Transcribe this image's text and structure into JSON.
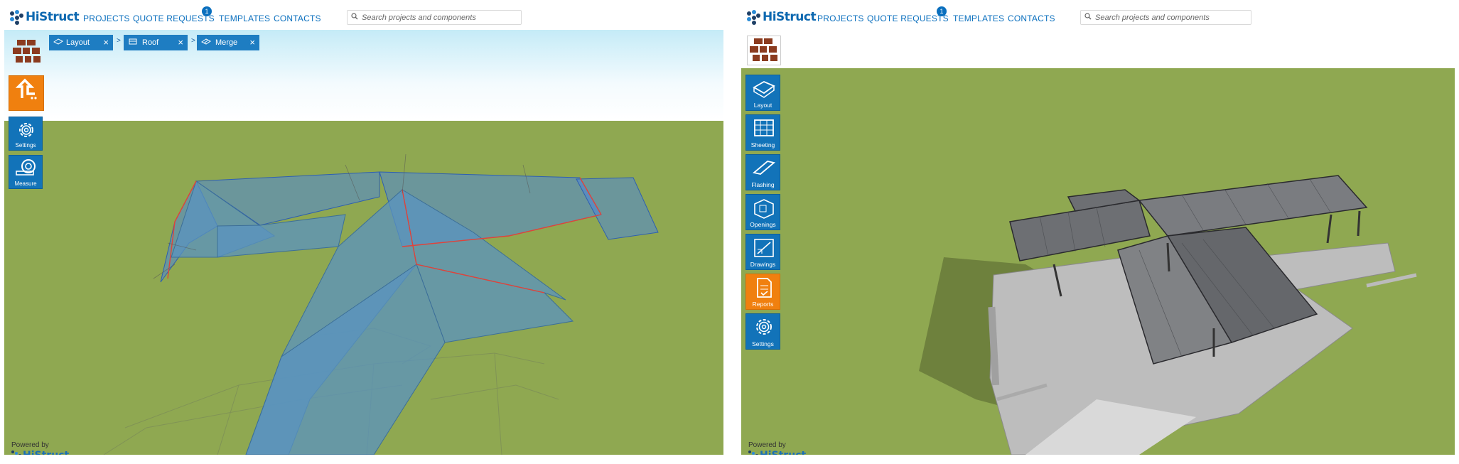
{
  "brand": {
    "name": "HiStruct",
    "powered_by": "Powered by",
    "colors": {
      "primary": "#1273b9",
      "accent": "#f0800f",
      "ground": "#8fa851"
    }
  },
  "left": {
    "nav": {
      "projects": "PROJECTS",
      "quote_requests": "QUOTE REQUESTS",
      "quote_badge": "1",
      "templates": "TEMPLATES",
      "contacts": "CONTACTS"
    },
    "search": {
      "placeholder": "Search projects and components"
    },
    "breadcrumb": [
      {
        "label": "Layout",
        "close": "×"
      },
      {
        "label": "Roof",
        "close": "×"
      },
      {
        "label": "Merge",
        "close": "×"
      }
    ],
    "breadcrumb_sep": ">",
    "sidebar": {
      "back_icon": "arrow-up-left-icon",
      "settings": "Settings",
      "measure": "Measure"
    }
  },
  "right": {
    "nav": {
      "projects": "PROJECTS",
      "quote_requests": "QUOTE REQUESTS",
      "quote_badge": "1",
      "templates": "TEMPLATES",
      "contacts": "CONTACTS"
    },
    "search": {
      "placeholder": "Search projects and components"
    },
    "sidebar": [
      {
        "label": "Layout",
        "icon": "layout-icon"
      },
      {
        "label": "Sheeting",
        "icon": "sheeting-icon"
      },
      {
        "label": "Flashing",
        "icon": "flashing-icon"
      },
      {
        "label": "Openings",
        "icon": "openings-icon"
      },
      {
        "label": "Drawings",
        "icon": "drawings-icon"
      },
      {
        "label": "Reports",
        "icon": "reports-icon"
      },
      {
        "label": "Settings",
        "icon": "gear-icon"
      }
    ]
  }
}
